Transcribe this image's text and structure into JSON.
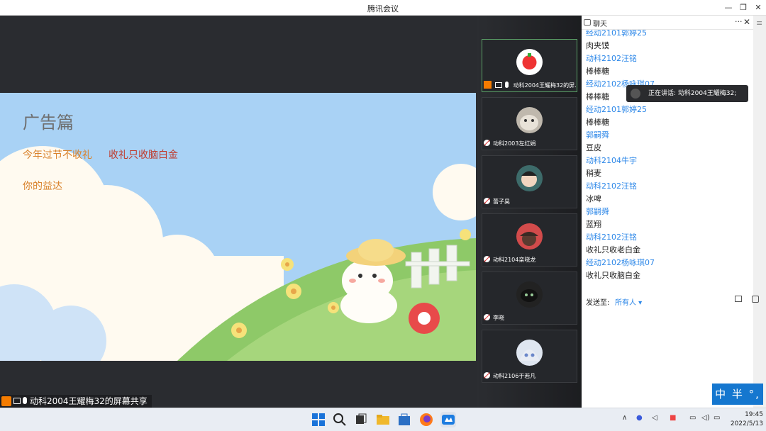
{
  "window": {
    "title": "腾讯会议"
  },
  "slide": {
    "title": "广告篇",
    "line1a": "今年过节不收礼",
    "line1b": "收礼只收脑白金",
    "line2": "你的益达"
  },
  "share_status": {
    "text": "动科2004王耀梅32的屏幕共享"
  },
  "participants": [
    {
      "name": "动科2004王耀梅32的屏..."
    },
    {
      "name": "动科2003左红娟"
    },
    {
      "name": "蕾子昊"
    },
    {
      "name": "动科2104栾晓龙"
    },
    {
      "name": "李晓"
    },
    {
      "name": "动科2106于若凡"
    }
  ],
  "chat": {
    "title": "聊天",
    "more_label": "···",
    "close_label": "✕",
    "menu_label": "≡",
    "messages": [
      {
        "kind": "sender",
        "text": "经动2101郭婷25"
      },
      {
        "kind": "text",
        "text": "肉夹馍"
      },
      {
        "kind": "sender",
        "text": "动科2102汪铭"
      },
      {
        "kind": "text",
        "text": "棒棒糖"
      },
      {
        "kind": "sender",
        "text": "经动2102杨咏琪07"
      },
      {
        "kind": "text",
        "text": "棒棒糖"
      },
      {
        "kind": "sender",
        "text": "经动2101郭婷25"
      },
      {
        "kind": "text",
        "text": "棒棒糖"
      },
      {
        "kind": "sender",
        "text": "郭嗣舜"
      },
      {
        "kind": "text",
        "text": "豆皮"
      },
      {
        "kind": "sender",
        "text": "动科2104牛宇"
      },
      {
        "kind": "text",
        "text": "稍麦"
      },
      {
        "kind": "sender",
        "text": "动科2102汪铭"
      },
      {
        "kind": "text",
        "text": "冰啤"
      },
      {
        "kind": "sender",
        "text": "郭嗣舜"
      },
      {
        "kind": "text",
        "text": "蓝翔"
      },
      {
        "kind": "sender",
        "text": "动科2102汪铭"
      },
      {
        "kind": "text",
        "text": "收礼只收老白金"
      },
      {
        "kind": "sender",
        "text": "经动2102杨咏琪07"
      },
      {
        "kind": "text",
        "text": "收礼只收脑白金"
      }
    ],
    "send_to_label": "发送至:",
    "send_to_value": "所有人 ▾"
  },
  "speaking": {
    "text": "正在讲话: 动科2004王耀梅32;"
  },
  "ime": {
    "text": "中 半 °,"
  },
  "taskbar": {
    "tray_chevron": "∧",
    "time": "19:45",
    "date": "2022/5/13"
  },
  "colors": {
    "sender": "#2c87e8",
    "accent": "#1577cf",
    "slide_red": "#c0392b",
    "slide_orange": "#d9822b"
  }
}
